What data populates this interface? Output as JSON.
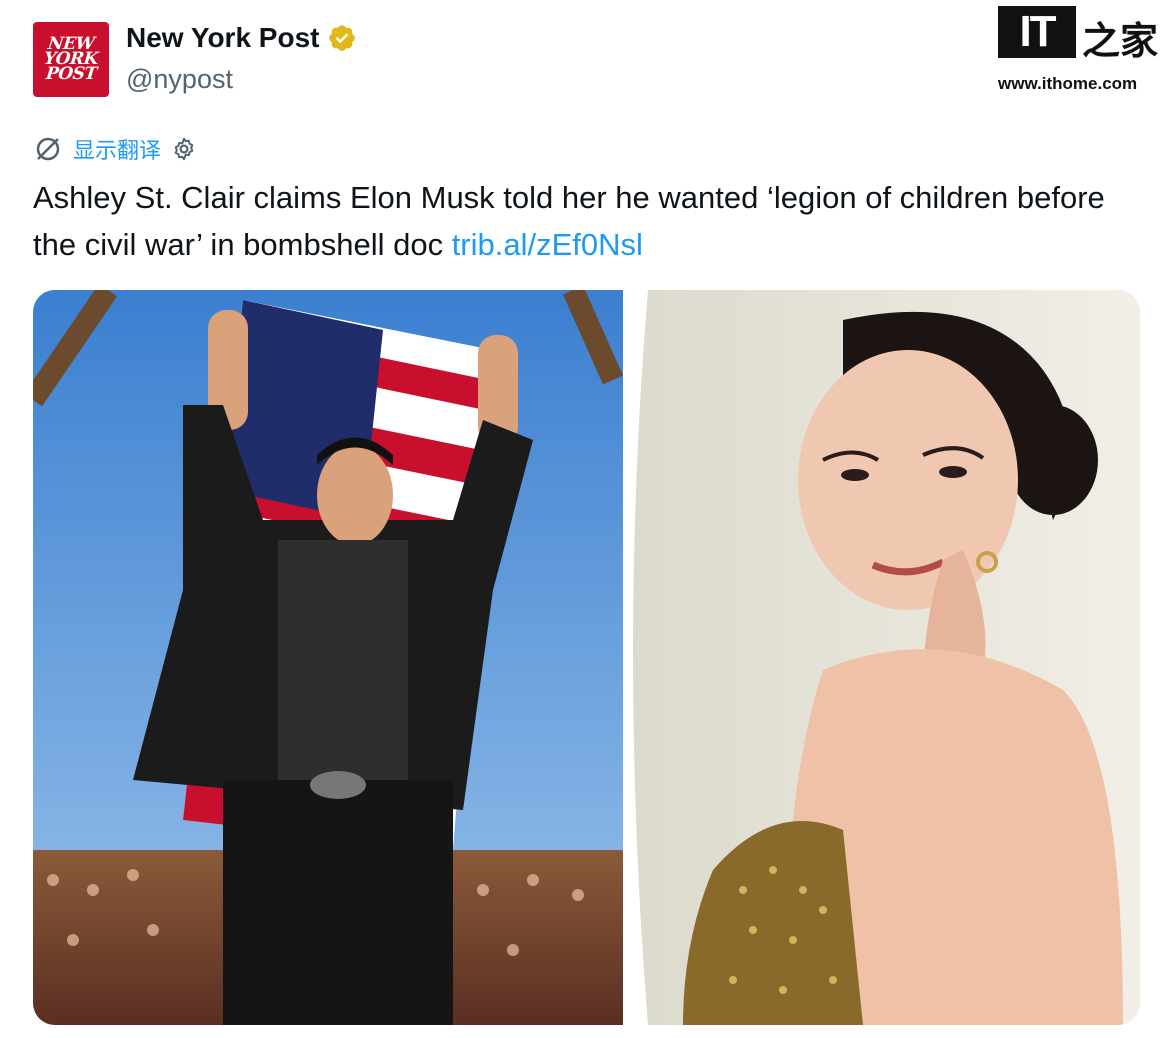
{
  "account": {
    "avatar_text": [
      "NEW",
      "YORK",
      "POST"
    ],
    "name": "New York Post",
    "handle": "@nypost",
    "verified_icon": "gold-verified-badge"
  },
  "watermark": {
    "brand_box": "IT",
    "brand_cn": "之家",
    "site": "www.ithome.com"
  },
  "translate": {
    "label": "显示翻译",
    "icons": [
      "no-translate-globe-icon",
      "gear-icon"
    ]
  },
  "tweet": {
    "text": "Ashley St. Clair claims Elon Musk told her he wanted ‘legion of children before the civil war’ in bombshell doc ",
    "link": "trib.al/zEf0Nsl"
  },
  "media": {
    "left_photo": "man-with-raised-arms-in-front-of-american-flag",
    "right_photo": "woman-looking-over-shoulder"
  },
  "colors": {
    "link_blue": "#1d9bf0",
    "nypost_red": "#c8102e",
    "verified_gold": "#e2b719",
    "handle_gray": "#536471"
  }
}
